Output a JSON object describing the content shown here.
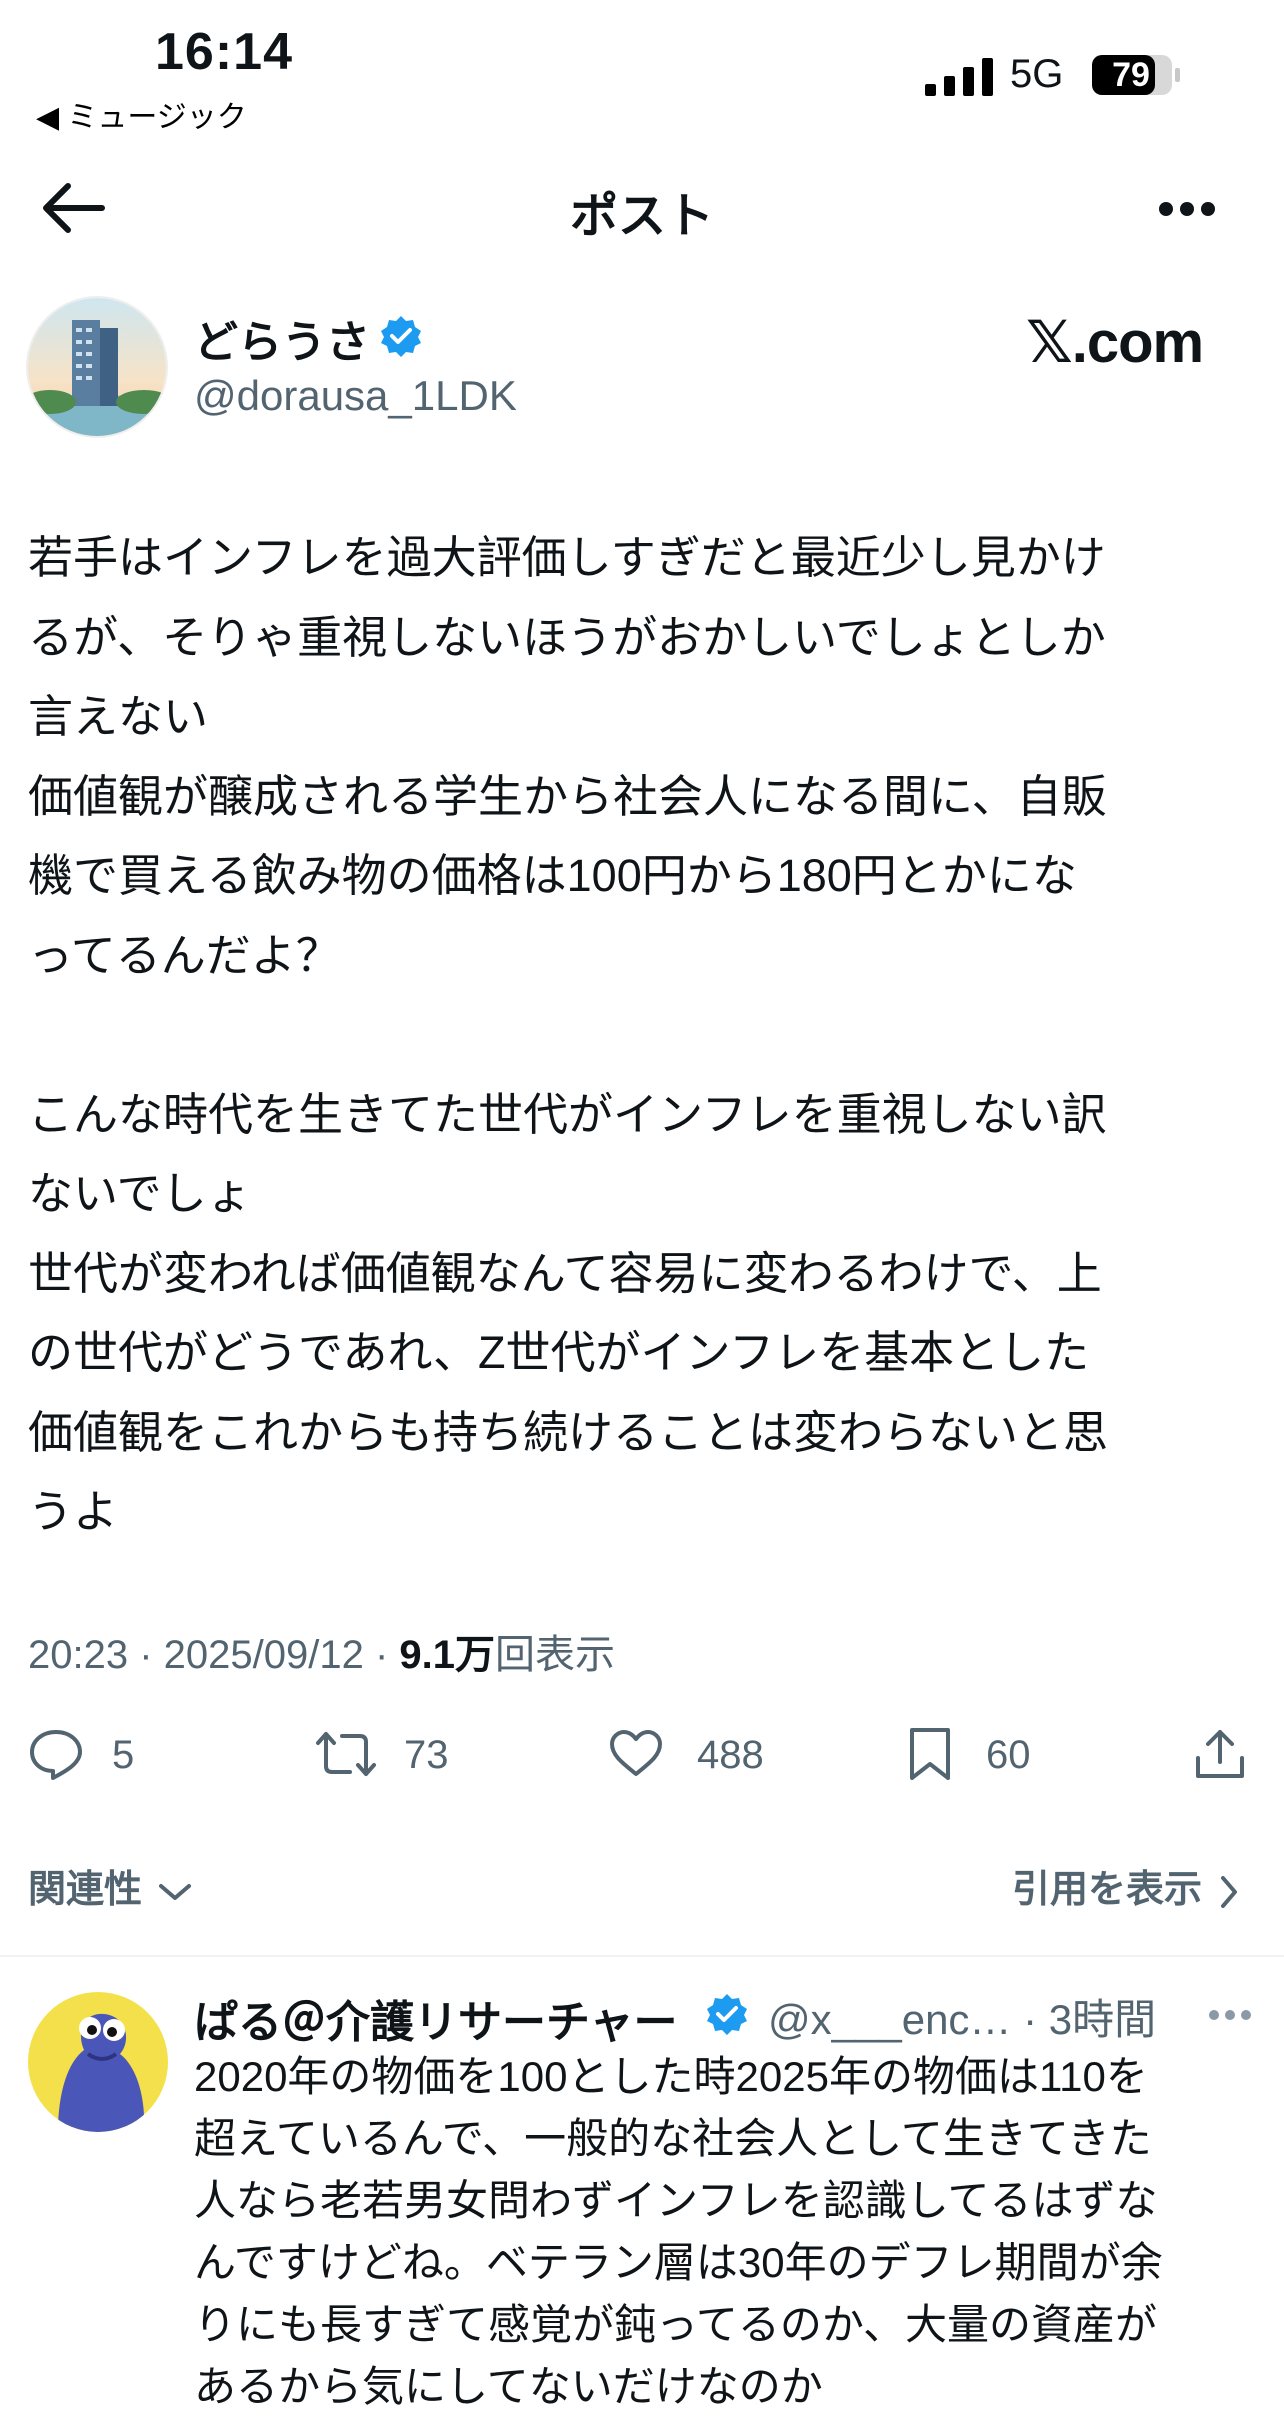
{
  "status_bar": {
    "time": "16:14",
    "back_app": "◀ ミュージック",
    "network": "5G",
    "battery": "79"
  },
  "nav": {
    "title": "ポスト"
  },
  "post": {
    "author_name": "どらうさ",
    "author_handle": "@dorausa_1LDK",
    "watermark": "𝕏.com",
    "text": "若手はインフレを過大評価しすぎだと最近少し見かけ\nるが、そりゃ重視しないほうがおかしいでしょとしか\n言えない\n価値観が醸成される学生から社会人になる間に、自販\n機で買える飲み物の価格は100円から180円とかにな\nってるんだよ？\n\nこんな時代を生きてた世代がインフレを重視しない訳\nないでしょ\n世代が変われば価値観なんて容易に変わるわけで、上\nの世代がどうであれ、Z世代がインフレを基本とした\n価値観をこれからも持ち続けることは変わらないと思\nうよ",
    "meta_prefix": "20:23 · 2025/09/12 · ",
    "views": "9.1万",
    "views_suffix": "回表示",
    "replies": "5",
    "reposts": "73",
    "likes": "488",
    "bookmarks": "60"
  },
  "relevance_label": "関連性",
  "quotes_label": "引用を表示",
  "reply": {
    "author_name": "ぱる＠介護リサーチャー",
    "handle_time": "@x___enc… · 3時間",
    "text": "2020年の物価を100とした時2025年の物価は110を\n超えているんで、一般的な社会人として生きてきた\n人なら老若男女問わずインフレを認識してるはずな\nんですけどね。ベテラン層は30年のデフレ期間が余\nりにも長すぎて感覚が鈍ってるのか、大量の資産が\nあるから気にしてないだけなのか"
  },
  "colors": {
    "verified": "#1d9bf0",
    "secondary_text": "#536471"
  },
  "icons": [
    "back-arrow-icon",
    "more-icon",
    "verified-icon",
    "reply-icon",
    "repost-icon",
    "like-icon",
    "bookmark-icon",
    "share-icon",
    "chevron-down-icon",
    "chevron-right-icon"
  ]
}
